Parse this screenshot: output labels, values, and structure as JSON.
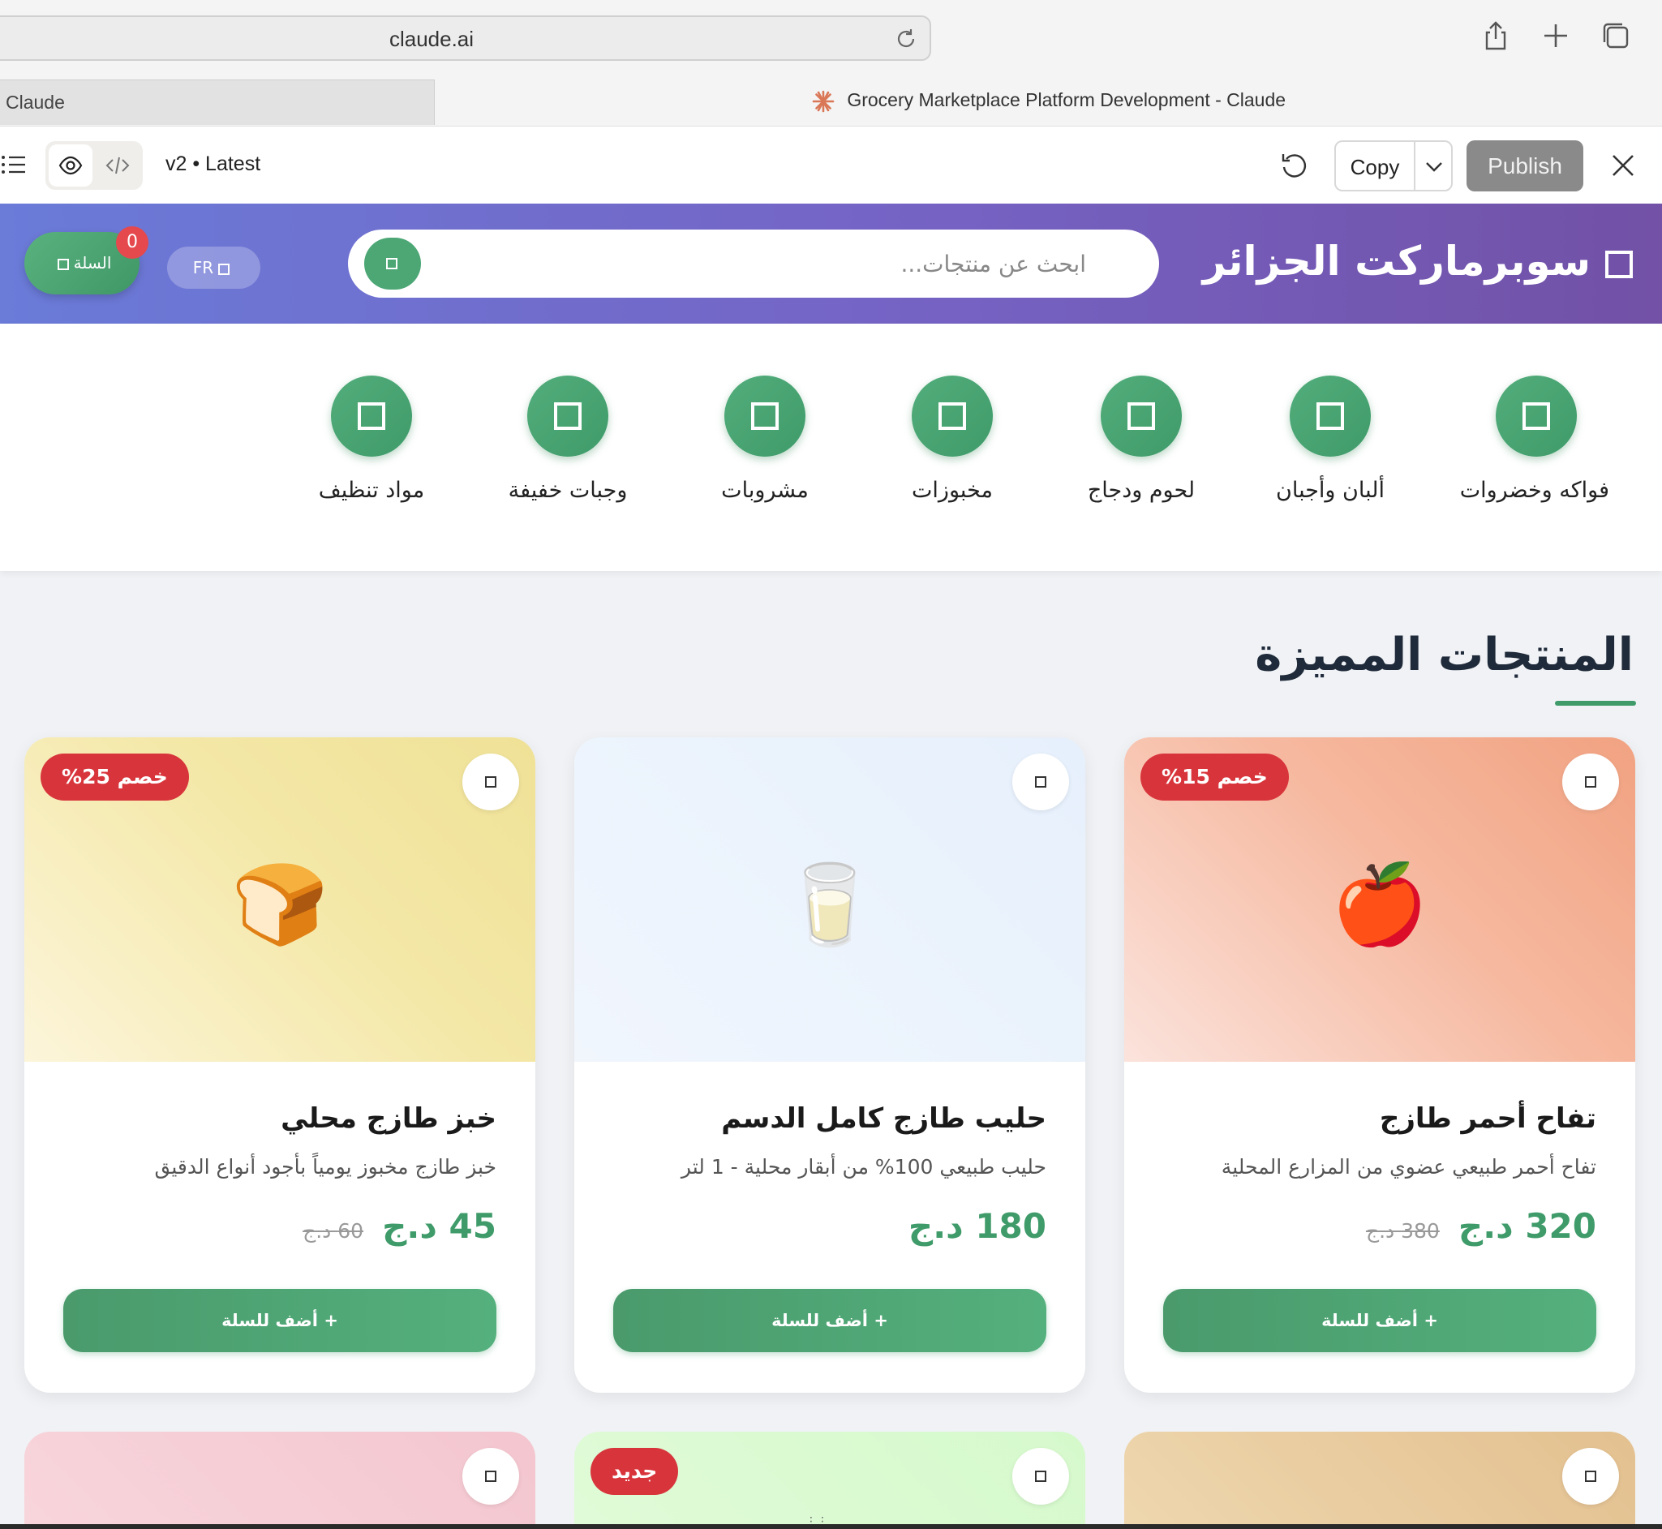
{
  "browser": {
    "url": "claude.ai",
    "tab_left_label": "Claude",
    "tab_active_label": "Grocery Marketplace Platform Development - Claude"
  },
  "artifact_bar": {
    "version_label": "v2 • Latest",
    "copy_label": "Copy",
    "publish_label": "Publish"
  },
  "header": {
    "brand": "سوبرماركت الجزائر",
    "search_placeholder": "ابحث عن منتجات...",
    "lang_label": "FR",
    "cart_label": "السلة",
    "cart_count": "0",
    "accent_color": "#3f9b69"
  },
  "categories": [
    {
      "label": "فواكه وخضروات"
    },
    {
      "label": "ألبان وأجبان"
    },
    {
      "label": "لحوم ودجاج"
    },
    {
      "label": "مخبوزات"
    },
    {
      "label": "مشروبات"
    },
    {
      "label": "وجبات خفيفة"
    },
    {
      "label": "مواد تنظيف"
    }
  ],
  "featured": {
    "title": "المنتجات المميزة",
    "add_to_cart_label": "+ أضف للسلة",
    "products": [
      {
        "name": "تفاح أحمر طازج",
        "description": "تفاح أحمر طبيعي عضوي من المزارع المحلية",
        "price": "320 د.ج",
        "old_price": "380 د.ج",
        "badge": "خصم 15%",
        "emoji": "🍎"
      },
      {
        "name": "حليب طازج كامل الدسم",
        "description": "حليب طبيعي 100% من أبقار محلية - 1 لتر",
        "price": "180 د.ج",
        "old_price": "",
        "badge": "",
        "emoji": "🥛"
      },
      {
        "name": "خبز طازج محلي",
        "description": "خبز طازج مخبوز يومياً بأجود أنواع الدقيق",
        "price": "45 د.ج",
        "old_price": "60 د.ج",
        "badge": "خصم 25%",
        "emoji": "🍞"
      }
    ],
    "next_row_badge": "جديد"
  }
}
